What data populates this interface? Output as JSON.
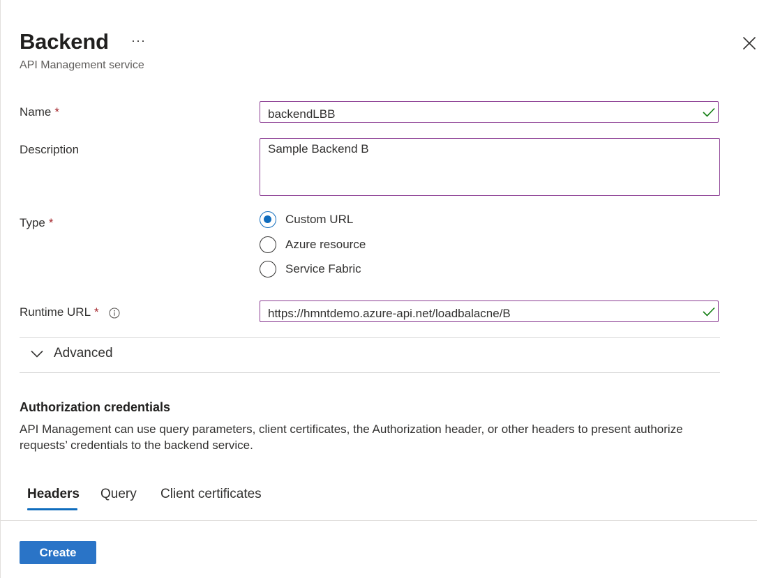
{
  "header": {
    "title": "Backend",
    "more_label": "···",
    "subtitle": "API Management service"
  },
  "form": {
    "name": {
      "label": "Name",
      "required_mark": "*",
      "value": "backendLBB"
    },
    "description": {
      "label": "Description",
      "value": "Sample Backend B"
    },
    "type": {
      "label": "Type",
      "required_mark": "*",
      "options": [
        {
          "label": "Custom URL",
          "selected": true
        },
        {
          "label": "Azure resource",
          "selected": false
        },
        {
          "label": "Service Fabric",
          "selected": false
        }
      ]
    },
    "runtime_url": {
      "label": "Runtime URL",
      "required_mark": "*",
      "value": "https://hmntdemo.azure-api.net/loadbalacne/B"
    },
    "advanced": {
      "label": "Advanced",
      "expanded": false
    }
  },
  "auth": {
    "title": "Authorization credentials",
    "description": "API Management can use query parameters, client certificates, the Authorization header, or other headers to present authorize requests’ credentials to the backend service.",
    "tabs": [
      {
        "label": "Headers",
        "active": true
      },
      {
        "label": "Query",
        "active": false
      },
      {
        "label": "Client certificates",
        "active": false
      }
    ]
  },
  "footer": {
    "create_label": "Create"
  },
  "colors": {
    "accent": "#0f6cbd",
    "primary_button": "#2a74c7",
    "input_border": "#8a3b92",
    "valid_check": "#107c10",
    "required": "#a4262c"
  },
  "icons": {
    "close": "close-icon",
    "more": "more-icon",
    "valid": "checkmark-icon",
    "info": "info-icon",
    "expand": "chevron-down-icon"
  }
}
